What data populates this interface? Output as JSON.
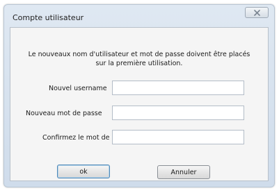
{
  "window": {
    "title": "Compte utilisateur",
    "close_icon": "close-icon"
  },
  "message": "Le nouveaux nom d'utilisateur et mot de passe doivent être placés sur la première utilisation.",
  "form": {
    "username_label": "Nouvel username",
    "username_value": "",
    "password_label": "Nouveau mot de passe",
    "password_value": "",
    "confirm_label": "Confirmez le mot de",
    "confirm_value": ""
  },
  "buttons": {
    "ok_label": "ok",
    "cancel_label": "Annuler"
  }
}
